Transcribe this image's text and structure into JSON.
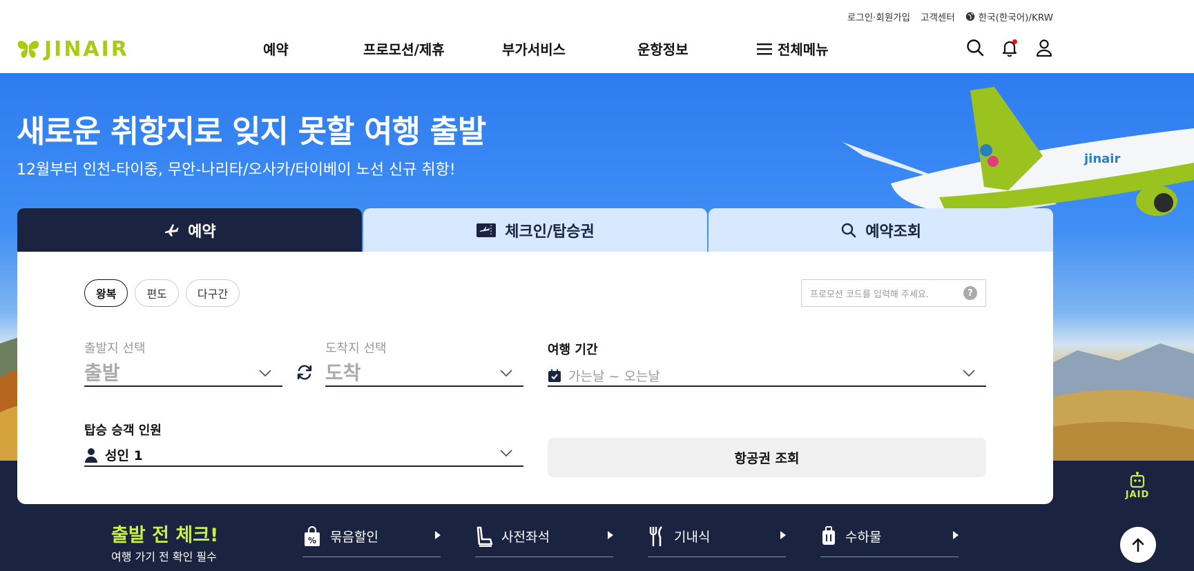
{
  "header": {
    "utility": {
      "login_label": "로그인·회원가입",
      "support_label": "고객센터",
      "language_label": "한국(한국어)/KRW"
    },
    "logo": {
      "text": "JINAIR",
      "color": "#a7cc14"
    },
    "nav": [
      {
        "label": "예약"
      },
      {
        "label": "프로모션/제휴"
      },
      {
        "label": "부가서비스"
      },
      {
        "label": "운항정보"
      },
      {
        "label": "전체메뉴",
        "icon": "menu-icon"
      }
    ],
    "icons": [
      "search-icon",
      "bell-icon",
      "user-icon"
    ]
  },
  "hero": {
    "title": "새로운 취항지로 잊지 못할 여행 출발",
    "subtitle": "12월부터 인천-타이중, 무안-나리타/오사카/타이베이 노선 신규 취항!"
  },
  "booking": {
    "tabs": [
      {
        "label": "예약",
        "icon": "plane-icon",
        "active": true
      },
      {
        "label": "체크인/탑승권",
        "icon": "ticket-icon",
        "active": false
      },
      {
        "label": "예약조회",
        "icon": "search-icon",
        "active": false
      }
    ],
    "trip_types": [
      {
        "label": "왕복",
        "selected": true
      },
      {
        "label": "편도",
        "selected": false
      },
      {
        "label": "다구간",
        "selected": false
      }
    ],
    "promo_placeholder": "프로모션 코드를 입력해 주세요.",
    "promo_help": "?",
    "origin": {
      "label": "출발지 선택",
      "value": "출발"
    },
    "destination": {
      "label": "도착지 선택",
      "value": "도착"
    },
    "dates": {
      "label": "여행 기간",
      "placeholder": "가는날 ~ 오는날"
    },
    "passengers": {
      "label": "탑승 승객 인원",
      "value": "성인 1"
    },
    "search_button": "항공권 조회"
  },
  "quick_check": {
    "title": "출발 전 체크!",
    "subtitle": "여행 가기 전 확인 필수",
    "items": [
      {
        "label": "묶음할인",
        "icon": "discount-bag-icon"
      },
      {
        "label": "사전좌석",
        "icon": "seat-icon"
      },
      {
        "label": "기내식",
        "icon": "meal-icon"
      },
      {
        "label": "수하물",
        "icon": "luggage-icon"
      }
    ]
  },
  "floating": {
    "chatbot_label": "JAID",
    "top_button": "back-to-top"
  },
  "colors": {
    "navy": "#1a2340",
    "accent_green": "#c9ef4b",
    "brand_green": "#a7cc14",
    "tab_idle": "#d8e9ff"
  }
}
